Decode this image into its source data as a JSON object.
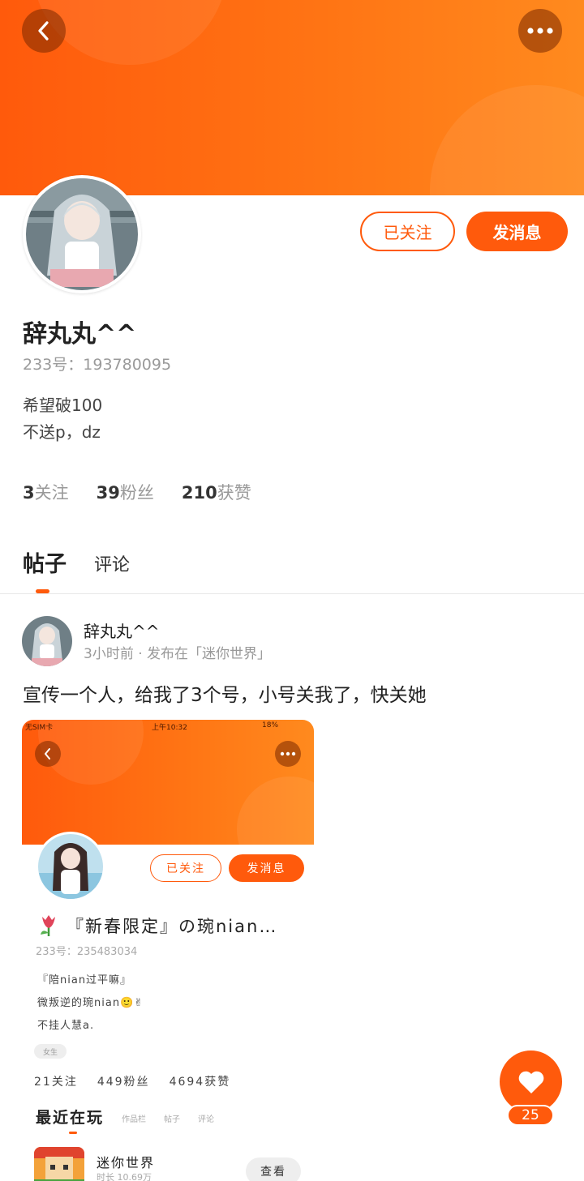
{
  "header": {
    "back_icon": "chevron-left-icon",
    "more_icon": "more-dots-icon"
  },
  "profile": {
    "username": "辞丸丸^^",
    "uid": "233号：193780095",
    "bio_line1": "希望破100",
    "bio_line2": "不送p，dz",
    "followed_label": "已关注",
    "message_label": "发消息",
    "stats": {
      "following_count": "3",
      "following_label": "关注",
      "fans_count": "39",
      "fans_label": "粉丝",
      "likes_count": "210",
      "likes_label": "获赞"
    }
  },
  "tabs": {
    "posts": "帖子",
    "comments": "评论"
  },
  "post": {
    "author": "辞丸丸^^",
    "meta": "3小时前 · 发布在「迷你世界」",
    "text": "宣传一个人，给我了3个号，小号关我了，快关她",
    "image": {
      "status_left": "无SIM卡",
      "status_time": "上午10:32",
      "status_battery": "18%",
      "followed_label": "已关注",
      "message_label": "发消息",
      "name": "『新春限定』の琬nian…",
      "uid": "233号：235483034",
      "bio_line1": "『陪nian过平嘛』",
      "bio_line2": "微叛逆的琬nian🙂✌",
      "bio_line3": "不挂人慧a.",
      "tag": "女生",
      "stats": {
        "following": "21关注",
        "fans": "449粉丝",
        "likes": "4694获赞"
      },
      "tab_active": "最近在玩",
      "tab_works": "作品栏",
      "tab_posts": "帖子",
      "tab_comments": "评论",
      "game_name": "迷你世界",
      "game_sub": "时长 10.69万",
      "look_label": "查看"
    }
  },
  "like": {
    "count": "25"
  },
  "colors": {
    "accent": "#ff5a0c",
    "banner_start": "#ff5a0c",
    "banner_end": "#ff8a1e"
  }
}
